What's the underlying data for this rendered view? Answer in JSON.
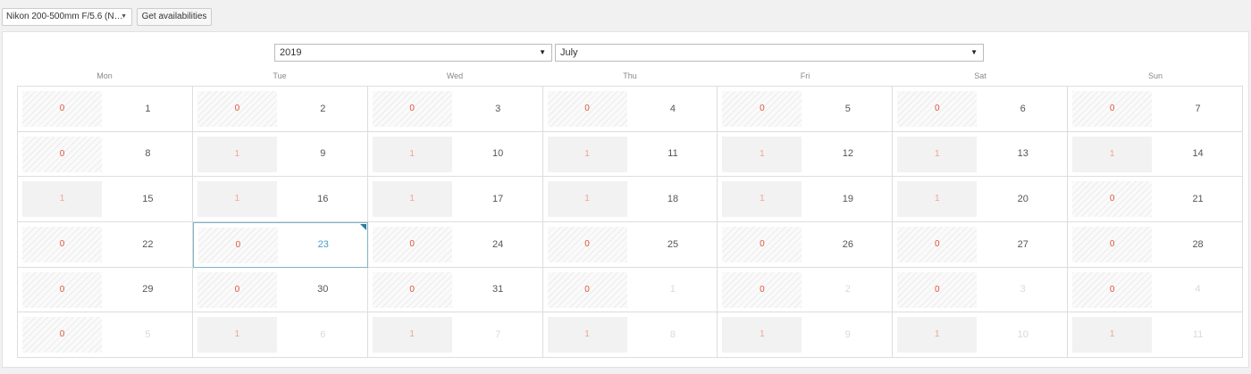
{
  "toolbar": {
    "product_select": "Nikon 200-500mm F/5.6 (N…",
    "arrow_icon": "▼",
    "get_availabilities": "Get availabilities"
  },
  "calendar": {
    "year": "2019",
    "month": "July",
    "weekdays": [
      "Mon",
      "Tue",
      "Wed",
      "Thu",
      "Fri",
      "Sat",
      "Sun"
    ],
    "weeks": [
      [
        {
          "avail": "0",
          "day": "1",
          "status": "booked",
          "in_month": true
        },
        {
          "avail": "0",
          "day": "2",
          "status": "booked",
          "in_month": true
        },
        {
          "avail": "0",
          "day": "3",
          "status": "booked",
          "in_month": true
        },
        {
          "avail": "0",
          "day": "4",
          "status": "booked",
          "in_month": true
        },
        {
          "avail": "0",
          "day": "5",
          "status": "booked",
          "in_month": true
        },
        {
          "avail": "0",
          "day": "6",
          "status": "booked",
          "in_month": true
        },
        {
          "avail": "0",
          "day": "7",
          "status": "booked",
          "in_month": true
        }
      ],
      [
        {
          "avail": "0",
          "day": "8",
          "status": "booked",
          "in_month": true
        },
        {
          "avail": "1",
          "day": "9",
          "status": "free",
          "in_month": true
        },
        {
          "avail": "1",
          "day": "10",
          "status": "free",
          "in_month": true
        },
        {
          "avail": "1",
          "day": "11",
          "status": "free",
          "in_month": true
        },
        {
          "avail": "1",
          "day": "12",
          "status": "free",
          "in_month": true
        },
        {
          "avail": "1",
          "day": "13",
          "status": "free",
          "in_month": true
        },
        {
          "avail": "1",
          "day": "14",
          "status": "free",
          "in_month": true
        }
      ],
      [
        {
          "avail": "1",
          "day": "15",
          "status": "free",
          "in_month": true
        },
        {
          "avail": "1",
          "day": "16",
          "status": "free",
          "in_month": true
        },
        {
          "avail": "1",
          "day": "17",
          "status": "free",
          "in_month": true
        },
        {
          "avail": "1",
          "day": "18",
          "status": "free",
          "in_month": true
        },
        {
          "avail": "1",
          "day": "19",
          "status": "free",
          "in_month": true
        },
        {
          "avail": "1",
          "day": "20",
          "status": "free",
          "in_month": true
        },
        {
          "avail": "0",
          "day": "21",
          "status": "booked",
          "in_month": true
        }
      ],
      [
        {
          "avail": "0",
          "day": "22",
          "status": "booked",
          "in_month": true
        },
        {
          "avail": "0",
          "day": "23",
          "status": "booked",
          "in_month": true,
          "today": true
        },
        {
          "avail": "0",
          "day": "24",
          "status": "booked",
          "in_month": true
        },
        {
          "avail": "0",
          "day": "25",
          "status": "booked",
          "in_month": true
        },
        {
          "avail": "0",
          "day": "26",
          "status": "booked",
          "in_month": true
        },
        {
          "avail": "0",
          "day": "27",
          "status": "booked",
          "in_month": true
        },
        {
          "avail": "0",
          "day": "28",
          "status": "booked",
          "in_month": true
        }
      ],
      [
        {
          "avail": "0",
          "day": "29",
          "status": "booked",
          "in_month": true
        },
        {
          "avail": "0",
          "day": "30",
          "status": "booked",
          "in_month": true
        },
        {
          "avail": "0",
          "day": "31",
          "status": "booked",
          "in_month": true
        },
        {
          "avail": "0",
          "day": "1",
          "status": "booked",
          "in_month": false
        },
        {
          "avail": "0",
          "day": "2",
          "status": "booked",
          "in_month": false
        },
        {
          "avail": "0",
          "day": "3",
          "status": "booked",
          "in_month": false
        },
        {
          "avail": "0",
          "day": "4",
          "status": "booked",
          "in_month": false
        }
      ],
      [
        {
          "avail": "0",
          "day": "5",
          "status": "booked",
          "in_month": false
        },
        {
          "avail": "1",
          "day": "6",
          "status": "free",
          "in_month": false
        },
        {
          "avail": "1",
          "day": "7",
          "status": "free",
          "in_month": false
        },
        {
          "avail": "1",
          "day": "8",
          "status": "free",
          "in_month": false
        },
        {
          "avail": "1",
          "day": "9",
          "status": "free",
          "in_month": false
        },
        {
          "avail": "1",
          "day": "10",
          "status": "free",
          "in_month": false
        },
        {
          "avail": "1",
          "day": "11",
          "status": "free",
          "in_month": false
        }
      ]
    ]
  },
  "colors": {
    "booked_count": "#e0553a",
    "free_count": "#f0a58f",
    "today_border": "#7fb3c8",
    "today_day": "#4a9cc7",
    "corner_marker": "#2c7d9f"
  }
}
